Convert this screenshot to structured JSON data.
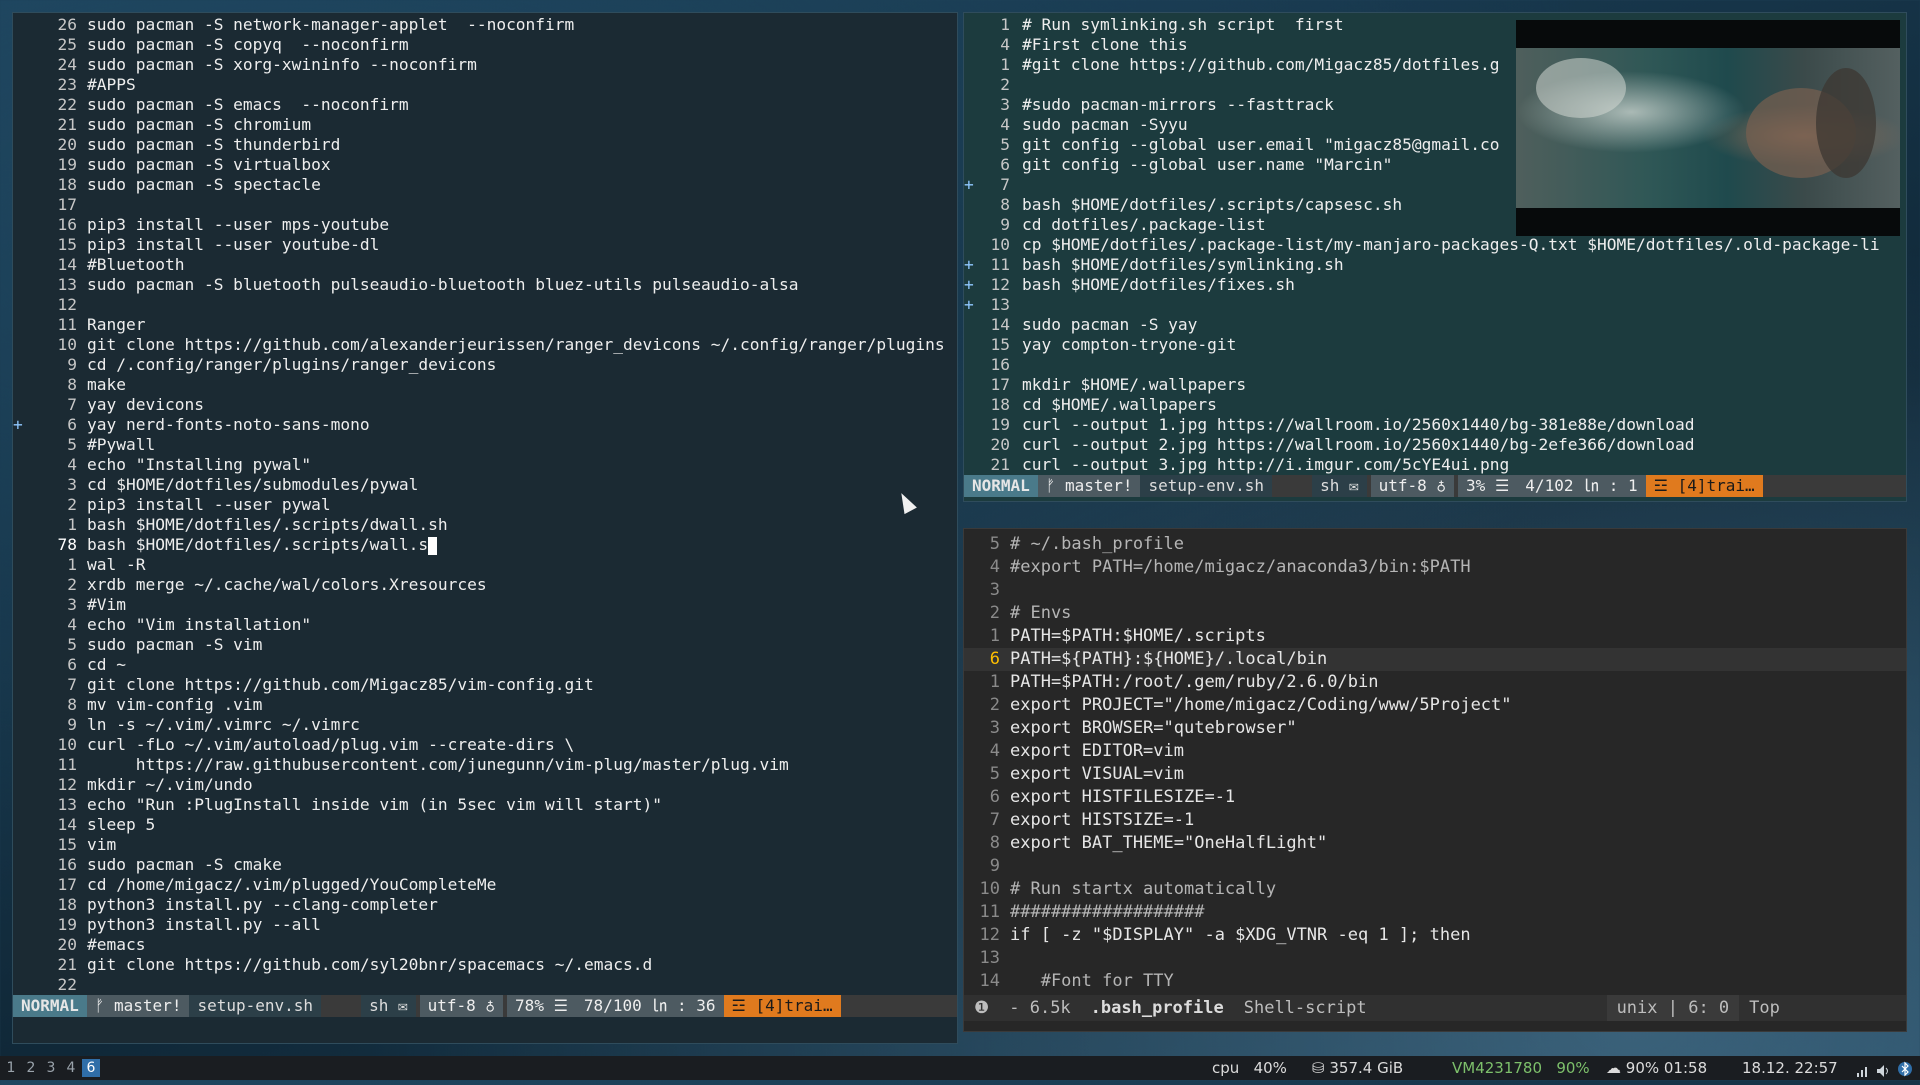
{
  "colors": {
    "accent_orange": "#e07a1e",
    "mode_blue": "#4a7a8a",
    "string_blue": "#6fb6ff",
    "workspace_active": "#2f6ea8"
  },
  "left_pane": {
    "lines": [
      {
        "num": "26",
        "text": "sudo pacman -S network-manager-applet  --noconfirm"
      },
      {
        "num": "25",
        "text": "sudo pacman -S copyq  --noconfirm"
      },
      {
        "num": "24",
        "text": "sudo pacman -S xorg-xwininfo --noconfirm"
      },
      {
        "num": "23",
        "text": "#APPS"
      },
      {
        "num": "22",
        "text": "sudo pacman -S emacs  --noconfirm"
      },
      {
        "num": "21",
        "text": "sudo pacman -S chromium"
      },
      {
        "num": "20",
        "text": "sudo pacman -S thunderbird"
      },
      {
        "num": "19",
        "text": "sudo pacman -S virtualbox"
      },
      {
        "num": "18",
        "text": "sudo pacman -S spectacle"
      },
      {
        "num": "17",
        "text": ""
      },
      {
        "num": "16",
        "text": "pip3 install --user mps-youtube"
      },
      {
        "num": "15",
        "text": "pip3 install --user youtube-dl"
      },
      {
        "num": "14",
        "text": "#Bluetooth"
      },
      {
        "num": "13",
        "text": "sudo pacman -S bluetooth pulseaudio-bluetooth bluez-utils pulseaudio-alsa"
      },
      {
        "num": "12",
        "text": ""
      },
      {
        "num": "11",
        "text": "Ranger"
      },
      {
        "num": "10",
        "text": "git clone https://github.com/alexanderjeurissen/ranger_devicons ~/.config/ranger/plugins"
      },
      {
        "num": "9",
        "text": "cd /.config/ranger/plugins/ranger_devicons"
      },
      {
        "num": "8",
        "text": "make"
      },
      {
        "num": "7",
        "text": "yay devicons"
      },
      {
        "num": "6",
        "text": "yay nerd-fonts-noto-sans-mono",
        "sign": "+"
      },
      {
        "num": "5",
        "text": "#Pywall"
      },
      {
        "num": "4",
        "text": "echo \"Installing pywal\""
      },
      {
        "num": "3",
        "text": "cd $HOME/dotfiles/submodules/pywal"
      },
      {
        "num": "2",
        "text": "pip3 install --user pywal"
      },
      {
        "num": "1",
        "text": "bash $HOME/dotfiles/.scripts/dwall.sh"
      },
      {
        "num": "78",
        "text": "bash $HOME/dotfiles/.scripts/wall.s",
        "current": true
      },
      {
        "num": "1",
        "text": "wal -R"
      },
      {
        "num": "2",
        "text": "xrdb merge ~/.cache/wal/colors.Xresources"
      },
      {
        "num": "3",
        "text": "#Vim"
      },
      {
        "num": "4",
        "text": "echo \"Vim installation\""
      },
      {
        "num": "5",
        "text": "sudo pacman -S vim"
      },
      {
        "num": "6",
        "text": "cd ~"
      },
      {
        "num": "7",
        "text": "git clone https://github.com/Migacz85/vim-config.git"
      },
      {
        "num": "8",
        "text": "mv vim-config .vim"
      },
      {
        "num": "9",
        "text": "ln -s ~/.vim/.vimrc ~/.vimrc"
      },
      {
        "num": "10",
        "text": "curl -fLo ~/.vim/autoload/plug.vim --create-dirs \\"
      },
      {
        "num": "11",
        "text": "     https://raw.githubusercontent.com/junegunn/vim-plug/master/plug.vim"
      },
      {
        "num": "12",
        "text": "mkdir ~/.vim/undo"
      },
      {
        "num": "13",
        "text": "echo \"Run :PlugInstall inside vim (in 5sec vim will start)\""
      },
      {
        "num": "14",
        "text": "sleep 5"
      },
      {
        "num": "15",
        "text": "vim"
      },
      {
        "num": "16",
        "text": "sudo pacman -S cmake"
      },
      {
        "num": "17",
        "text": "cd /home/migacz/.vim/plugged/YouCompleteMe"
      },
      {
        "num": "18",
        "text": "python3 install.py --clang-completer"
      },
      {
        "num": "19",
        "text": "python3 install.py --all"
      },
      {
        "num": "20",
        "text": "#emacs"
      },
      {
        "num": "21",
        "text": "git clone https://github.com/syl20bnr/spacemacs ~/.emacs.d"
      },
      {
        "num": "22",
        "text": ""
      }
    ],
    "status": {
      "mode": "NORMAL",
      "branch": "ᚠ master!",
      "file": "setup-env.sh",
      "type": "sh",
      "type_icon": "✉",
      "encoding": "utf-8 ♁",
      "percent": "78% ☰",
      "position": "78/100 ㏑ :  36",
      "warning": "☲ [4]trai…"
    }
  },
  "top_right_pane": {
    "lines": [
      {
        "num": "1",
        "text": "# Run symlinking.sh script  first"
      },
      {
        "num": "4",
        "text": "#First clone this"
      },
      {
        "num": "1",
        "text": "#git clone https://github.com/Migacz85/dotfiles.g"
      },
      {
        "num": "2",
        "text": ""
      },
      {
        "num": "3",
        "text": "#sudo pacman-mirrors --fasttrack"
      },
      {
        "num": "4",
        "text": "sudo pacman -Syyu"
      },
      {
        "num": "5",
        "text": "git config --global user.email \"migacz85@gmail.co"
      },
      {
        "num": "6",
        "text": "git config --global user.name \"Marcin\""
      },
      {
        "num": "7",
        "text": "",
        "sign": "+"
      },
      {
        "num": "8",
        "text": "bash $HOME/dotfiles/.scripts/capsesc.sh"
      },
      {
        "num": "9",
        "text": "cd dotfiles/.package-list"
      },
      {
        "num": "10",
        "text": "cp $HOME/dotfiles/.package-list/my-manjaro-packages-Q.txt $HOME/dotfiles/.old-package-li"
      },
      {
        "num": "11",
        "text": "bash $HOME/dotfiles/symlinking.sh",
        "sign": "+"
      },
      {
        "num": "12",
        "text": "bash $HOME/dotfiles/fixes.sh",
        "sign": "+"
      },
      {
        "num": "13",
        "text": "",
        "sign": "+"
      },
      {
        "num": "14",
        "text": "sudo pacman -S yay"
      },
      {
        "num": "15",
        "text": "yay compton-tryone-git"
      },
      {
        "num": "16",
        "text": ""
      },
      {
        "num": "17",
        "text": "mkdir $HOME/.wallpapers"
      },
      {
        "num": "18",
        "text": "cd $HOME/.wallpapers"
      },
      {
        "num": "19",
        "text": "curl --output 1.jpg https://wallroom.io/2560x1440/bg-381e88e/download"
      },
      {
        "num": "20",
        "text": "curl --output 2.jpg https://wallroom.io/2560x1440/bg-2efe366/download"
      },
      {
        "num": "21",
        "text": "curl --output 3.jpg http://i.imgur.com/5cYE4ui.png"
      }
    ],
    "status": {
      "mode": "NORMAL",
      "branch": "ᚠ master!",
      "file": "setup-env.sh",
      "type": "sh",
      "type_icon": "✉",
      "encoding": "utf-8 ♁",
      "percent": "3% ☰",
      "position": "4/102 ㏑ :  1",
      "warning": "☲ [4]trai…"
    }
  },
  "bottom_right_pane": {
    "lines": [
      {
        "num": "5",
        "text": "# ~/.bash_profile",
        "kind": "comment"
      },
      {
        "num": "4",
        "text": "#export PATH=/home/migacz/anaconda3/bin:$PATH",
        "kind": "comment"
      },
      {
        "num": "3",
        "text": ""
      },
      {
        "num": "2",
        "text": "# Envs",
        "kind": "comment"
      },
      {
        "num": "1",
        "text": "PATH=$PATH:$HOME/.scripts"
      },
      {
        "num": "6",
        "text": "PATH=${PATH}:${HOME}/.local/bin",
        "current": true
      },
      {
        "num": "1",
        "text": "PATH=$PATH:/root/.gem/ruby/2.6.0/bin"
      },
      {
        "num": "2",
        "text": "export PROJECT=\"/home/migacz/Coding/www/5Project\""
      },
      {
        "num": "3",
        "text": "export BROWSER=\"qutebrowser\""
      },
      {
        "num": "4",
        "text": "export EDITOR=vim"
      },
      {
        "num": "5",
        "text": "export VISUAL=vim"
      },
      {
        "num": "6",
        "text": "export HISTFILESIZE=-1"
      },
      {
        "num": "7",
        "text": "export HISTSIZE=-1"
      },
      {
        "num": "8",
        "text": "export BAT_THEME=\"OneHalfLight\""
      },
      {
        "num": "9",
        "text": ""
      },
      {
        "num": "10",
        "text": "# Run startx automatically",
        "kind": "comment"
      },
      {
        "num": "11",
        "text": "###################",
        "kind": "comment"
      },
      {
        "num": "12",
        "text": "if [ -z \"$DISPLAY\" -a $XDG_VTNR -eq 1 ]; then"
      },
      {
        "num": "13",
        "text": ""
      },
      {
        "num": "14",
        "text": "   #Font for TTY",
        "kind": "comment"
      }
    ],
    "status": {
      "icon": "❶",
      "size": "-  6.5k",
      "file": ".bash_profile",
      "filetype": "Shell-script",
      "format": "unix | 6: 0",
      "position": "Top"
    }
  },
  "taskbar": {
    "workspaces": [
      "1",
      "2",
      "3",
      "4",
      "6"
    ],
    "active_workspace_index": 4,
    "cpu_label": "cpu",
    "cpu_value": "40%",
    "disk_icon": "⛁",
    "disk_value": "357.4 GiB",
    "vm_name": "VM4231780",
    "vm_value": "90%",
    "battery_icon": "☁",
    "battery_value": "90% 01:58",
    "datetime": "18.12. 22:57",
    "tray_icons": [
      "wifi-icon",
      "volume-icon",
      "bluetooth-icon"
    ]
  }
}
